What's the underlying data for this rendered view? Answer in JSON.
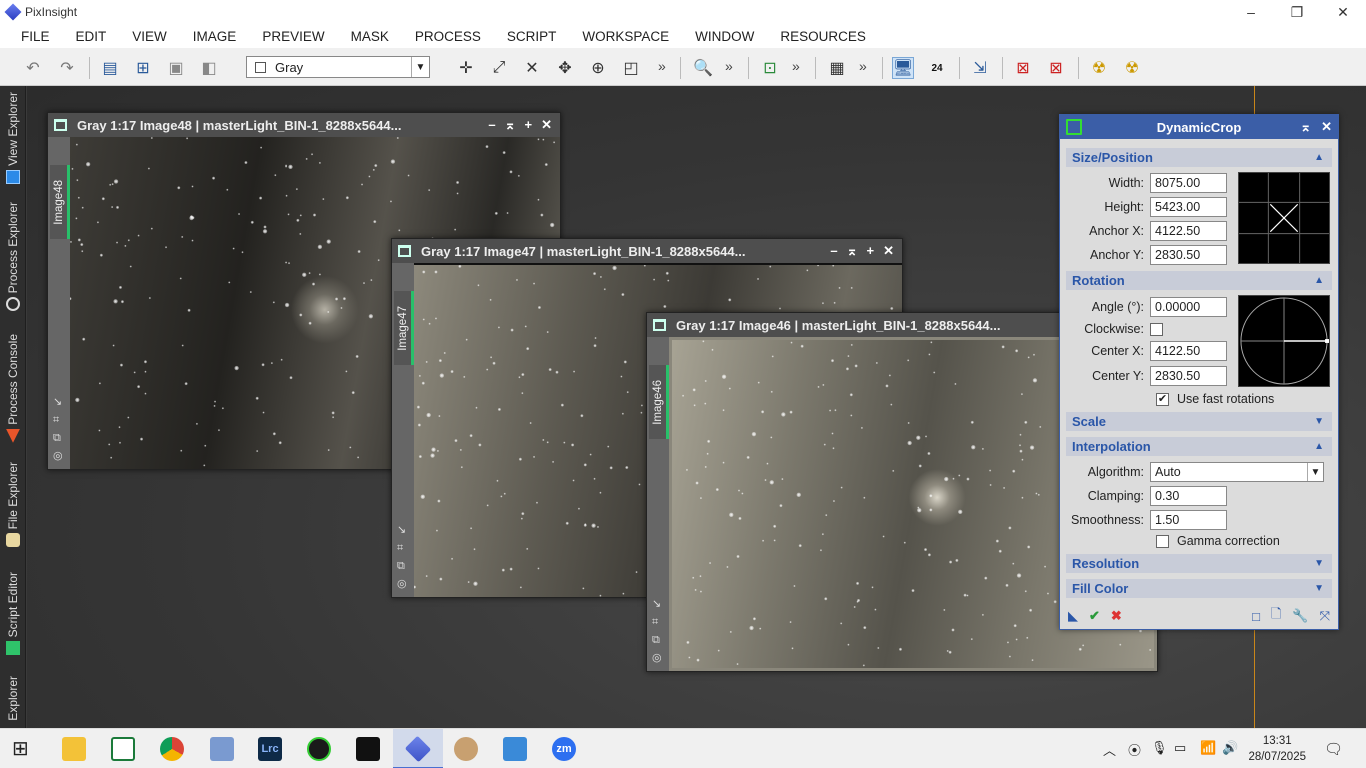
{
  "app": {
    "title": "PixInsight"
  },
  "window_controls": {
    "minimize": "–",
    "restore": "❐",
    "close": "✕"
  },
  "menu": [
    "FILE",
    "EDIT",
    "VIEW",
    "IMAGE",
    "PREVIEW",
    "MASK",
    "PROCESS",
    "SCRIPT",
    "WORKSPACE",
    "WINDOW",
    "RESOURCES"
  ],
  "toolbar": {
    "color_space": "Gray",
    "more": "»",
    "badge": "24"
  },
  "dock_tabs": {
    "view_explorer": "View Explorer",
    "process_explorer": "Process Explorer",
    "process_console": "Process Console",
    "file_explorer": "File Explorer",
    "script_editor": "Script Editor",
    "explorer": "Explorer"
  },
  "image_windows": [
    {
      "title": "Gray 1:17 Image48 | masterLight_BIN-1_8288x5644...",
      "tab": "Image48"
    },
    {
      "title": "Gray 1:17 Image47 | masterLight_BIN-1_8288x5644...",
      "tab": "Image47"
    },
    {
      "title": "Gray 1:17 Image46 | masterLight_BIN-1_8288x5644...",
      "tab": "Image46"
    }
  ],
  "image_controls": {
    "minimize": "–",
    "shade": "⌅",
    "maximize": "+",
    "close": "✕"
  },
  "dynamic_crop": {
    "title": "DynamicCrop",
    "size_position": {
      "label": "Size/Position",
      "width_label": "Width:",
      "width": "8075.00",
      "height_label": "Height:",
      "height": "5423.00",
      "anchor_x_label": "Anchor X:",
      "anchor_x": "4122.50",
      "anchor_y_label": "Anchor Y:",
      "anchor_y": "2830.50"
    },
    "rotation": {
      "label": "Rotation",
      "angle_label": "Angle (°):",
      "angle": "0.00000",
      "clockwise_label": "Clockwise:",
      "clockwise": false,
      "center_x_label": "Center X:",
      "center_x": "4122.50",
      "center_y_label": "Center Y:",
      "center_y": "2830.50",
      "fast_label": "Use fast rotations",
      "fast": true
    },
    "scale": {
      "label": "Scale"
    },
    "interpolation": {
      "label": "Interpolation",
      "algorithm_label": "Algorithm:",
      "algorithm": "Auto",
      "clamping_label": "Clamping:",
      "clamping": "0.30",
      "smoothness_label": "Smoothness:",
      "smoothness": "1.50",
      "gamma_label": "Gamma correction",
      "gamma": false
    },
    "resolution": {
      "label": "Resolution"
    },
    "fill_color": {
      "label": "Fill Color"
    }
  },
  "taskbar": {
    "time": "13:31",
    "date": "28/07/2025",
    "apps": [
      "Lrc",
      "zm"
    ]
  },
  "colors": {
    "accent": "#3b5ea7",
    "section_text": "#2a56a8",
    "tab_marker": "#28c06a"
  }
}
